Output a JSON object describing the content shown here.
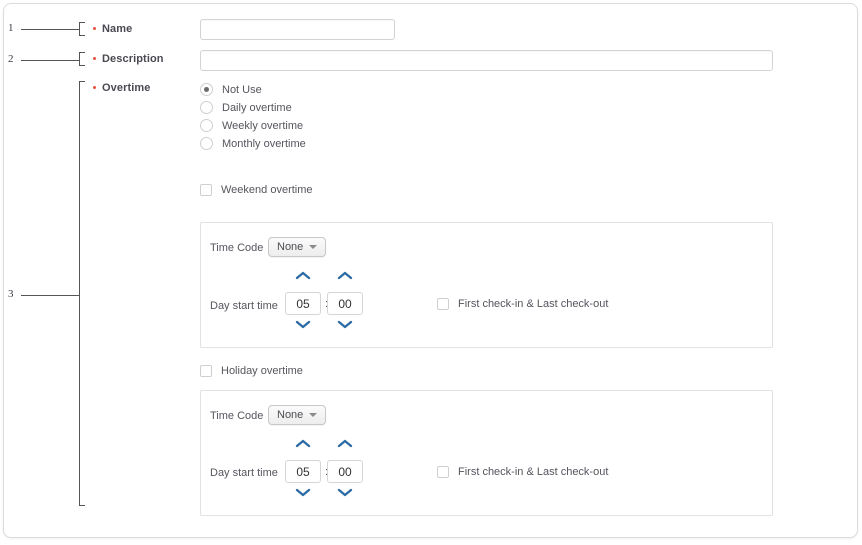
{
  "annotations": [
    {
      "number": "1",
      "target": "name-field"
    },
    {
      "number": "2",
      "target": "description-field"
    },
    {
      "number": "3",
      "target": "overtime-field"
    }
  ],
  "form": {
    "name": {
      "label": "Name",
      "required": true,
      "value": "",
      "placeholder": ""
    },
    "description": {
      "label": "Description",
      "required": true,
      "value": "",
      "placeholder": ""
    },
    "overtime": {
      "label": "Overtime",
      "required": true,
      "options": [
        {
          "label": "Not Use",
          "selected": true
        },
        {
          "label": "Daily overtime",
          "selected": false
        },
        {
          "label": "Weekly overtime",
          "selected": false
        },
        {
          "label": "Monthly overtime",
          "selected": false
        }
      ]
    },
    "weekend": {
      "checkbox_label": "Weekend overtime",
      "checked": false,
      "panel": {
        "time_code_label": "Time Code",
        "time_code_value": "None",
        "day_start_label": "Day start time",
        "hours": "05",
        "minutes": "00",
        "separator": ":",
        "check_label": "First check-in & Last check-out",
        "checked": false
      }
    },
    "holiday": {
      "checkbox_label": "Holiday overtime",
      "checked": false,
      "panel": {
        "time_code_label": "Time Code",
        "time_code_value": "None",
        "day_start_label": "Day start time",
        "hours": "05",
        "minutes": "00",
        "separator": ":",
        "check_label": "First check-in & Last check-out",
        "checked": false
      }
    }
  },
  "icons": {
    "caret_down": "chevron-down-icon",
    "spinner_up": "chevron-up-icon",
    "spinner_down": "chevron-down-icon",
    "required_marker": "required-dot-icon"
  },
  "colors": {
    "required": "#e8523f",
    "spinner_blue": "#2e6da4",
    "label_text": "#4a4a52",
    "body_text": "#55555d",
    "border": "#d3d3d3",
    "panel_border": "#e2e2e2"
  }
}
